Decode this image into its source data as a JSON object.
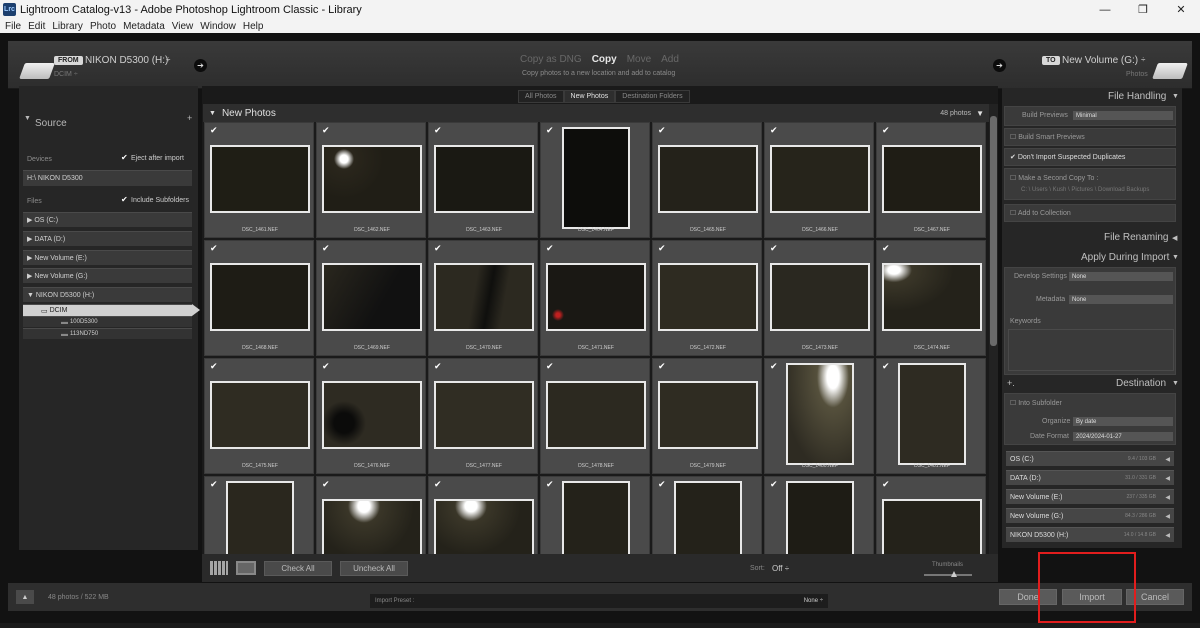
{
  "window": {
    "title": "Lightroom Catalog-v13 - Adobe Photoshop Lightroom Classic - Library",
    "app_icon": "Lrc",
    "controls": {
      "minimize": "—",
      "maximize": "❐",
      "close": "✕"
    }
  },
  "menu": [
    "File",
    "Edit",
    "Library",
    "Photo",
    "Metadata",
    "View",
    "Window",
    "Help"
  ],
  "topbar": {
    "from_label": "FROM",
    "source_name": "NIKON D5300 (H:)",
    "source_path": "DCIM ÷",
    "modes": [
      "Copy as DNG",
      "Copy",
      "Move",
      "Add"
    ],
    "active_mode": "Copy",
    "mode_description": "Copy photos to a new location and add to catalog",
    "to_label": "TO",
    "dest_name": "New Volume (G:)",
    "dest_path": "Photos"
  },
  "source_panel": {
    "title": "Source",
    "devices_label": "Devices",
    "eject_label": "Eject after import",
    "device": "H:\\ NIKON D5300",
    "files_label": "Files",
    "include_subfolders": "Include Subfolders",
    "drives": [
      "OS (C:)",
      "DATA (D:)",
      "New Volume (E:)",
      "New Volume (G:)",
      "NIKON D5300 (H:)"
    ],
    "dcim": "DCIM",
    "folders": [
      "100D5300",
      "113ND750"
    ]
  },
  "center": {
    "tabs": [
      "All Photos",
      "New Photos",
      "Destination Folders"
    ],
    "active_tab": "New Photos",
    "header_title": "New Photos",
    "photo_count": "48 photos",
    "filenames": [
      "DSC_1461.NEF",
      "DSC_1462.NEF",
      "DSC_1463.NEF",
      "DSC_1464.NEF",
      "DSC_1465.NEF",
      "DSC_1466.NEF",
      "DSC_1467.NEF",
      "DSC_1468.NEF",
      "DSC_1469.NEF",
      "DSC_1470.NEF",
      "DSC_1471.NEF",
      "DSC_1472.NEF",
      "DSC_1473.NEF",
      "DSC_1474.NEF",
      "DSC_1475.NEF",
      "DSC_1476.NEF",
      "DSC_1477.NEF",
      "DSC_1478.NEF",
      "DSC_1479.NEF",
      "DSC_1480.NEF",
      "DSC_1481.NEF"
    ],
    "check_all": "Check All",
    "uncheck_all": "Uncheck All",
    "sort_label": "Sort:",
    "sort_value": "Off ÷",
    "thumbnails_label": "Thumbnails"
  },
  "right_panel": {
    "file_handling": "File Handling",
    "build_previews_label": "Build Previews",
    "build_previews_value": "Minimal",
    "build_smart": "Build Smart Previews",
    "dont_import": "Don't Import Suspected Duplicates",
    "second_copy": "Make a Second Copy To :",
    "second_copy_path": "C: \\ Users \\ Kush \\ Pictures \\ Download Backups",
    "add_collection": "Add to Collection",
    "file_renaming": "File Renaming",
    "apply_during": "Apply During Import",
    "develop_label": "Develop Settings",
    "develop_value": "None",
    "metadata_label": "Metadata",
    "metadata_value": "None",
    "keywords_label": "Keywords",
    "destination": "Destination",
    "into_subfolder": "Into Subfolder",
    "organize_label": "Organize",
    "organize_value": "By date",
    "date_format_label": "Date Format",
    "date_format_value": "2024/2024-01-27",
    "volumes": [
      {
        "name": "OS (C:)",
        "size": "9.4 / 103 GB"
      },
      {
        "name": "DATA (D:)",
        "size": "31.0 / 331 GB"
      },
      {
        "name": "New Volume (E:)",
        "size": "237 / 335 GB"
      },
      {
        "name": "New Volume (G:)",
        "size": "84.3 / 286 GB"
      },
      {
        "name": "NIKON D5300 (H:)",
        "size": "14.0 / 14.8 GB"
      }
    ]
  },
  "bottom": {
    "status": "48 photos / 522 MB",
    "preset_label": "Import Preset :",
    "preset_value": "None ÷",
    "done": "Done",
    "import": "Import",
    "cancel": "Cancel"
  }
}
